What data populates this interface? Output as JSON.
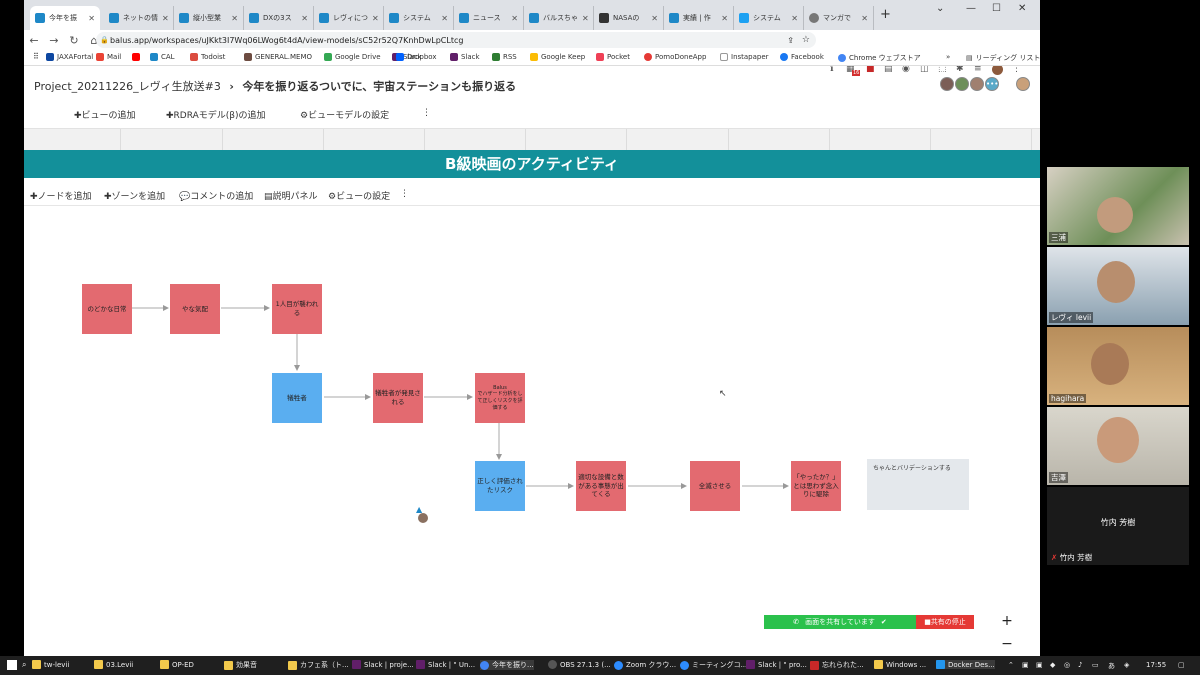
{
  "browser": {
    "tabs": [
      {
        "label": "今年を振",
        "active": true
      },
      {
        "label": "ネットの情"
      },
      {
        "label": "縦小型業"
      },
      {
        "label": "DXの3ス"
      },
      {
        "label": "レヴィにつ"
      },
      {
        "label": "システム"
      },
      {
        "label": "ニュース"
      },
      {
        "label": "バルスちゃ"
      },
      {
        "label": "NASAの"
      },
      {
        "label": "実績 | 作"
      },
      {
        "label": "システム"
      },
      {
        "label": "マンガで"
      }
    ],
    "new_tab": "+",
    "url": "balus.app/workspaces/uJKkt3I7Wq06LWog6t4dA/view-models/sC52r52Q7KnhDwLpCLtcg",
    "badge": "16",
    "bookmarks": [
      "JAXAFortal",
      "Mail",
      "",
      "CAL",
      "Todoist",
      "GENERAL.MEMO",
      "Google Drive",
      "Slack",
      "Dropbox",
      "Slack",
      "RSS",
      "Google Keep",
      "Pocket",
      "PomoDoneApp",
      "Instapaper",
      "Facebook",
      "Chrome ウェブストア"
    ],
    "bookmarks_more": "»",
    "reading_list": "リーディング リスト"
  },
  "app": {
    "breadcrumb": "Project_20211226_レヴィ生放送#3",
    "separator": "›",
    "title": "今年を振り返るついでに、宇宙ステーションも振り返る",
    "model_toolbar": {
      "add_view": "ビューの追加",
      "add_rdra": "RDRAモデル(β)の追加",
      "view_model_settings": "ビューモデルの設定",
      "more": "⋮"
    },
    "view_title": "B級映画のアクティビティ",
    "view_toolbar": {
      "add_node": "ノードを追加",
      "add_zone": "ゾーンを追加",
      "add_comment": "コメントの追加",
      "description_panel": "説明パネル",
      "view_settings": "ビューの設定",
      "more": "⋮"
    },
    "nodes": [
      {
        "label": "のどかな日常",
        "color": "#e36a70"
      },
      {
        "label": "やな気配",
        "color": "#e36a70"
      },
      {
        "label": "1人目が襲われる",
        "color": "#e36a70"
      },
      {
        "label": "犠牲者",
        "color": "#5aaef0"
      },
      {
        "label": "犠牲者が発見される",
        "color": "#e36a70"
      },
      {
        "label": "Balus\nでハザード分析をして正しくリスクを評価する",
        "color": "#e36a70"
      },
      {
        "label": "正しく評価されたリスク",
        "color": "#5aaef0"
      },
      {
        "label": "適切な設備と数がある事態が出てくる",
        "color": "#e36a70"
      },
      {
        "label": "全滅させる",
        "color": "#e36a70"
      },
      {
        "label": "「やったか？」とは思わず念入りに駆除",
        "color": "#e36a70"
      }
    ],
    "comment": "ちゃんとバリデーションする",
    "share": {
      "status": "画面を共有しています",
      "stop": "共有の停止"
    },
    "zoom_in": "+",
    "zoom_out": "−"
  },
  "zoom": {
    "participants": [
      {
        "name": "三浦"
      },
      {
        "name": "レヴィ levii"
      },
      {
        "name": "hagihara"
      },
      {
        "name": "吉澤"
      },
      {
        "name": "竹内 芳樹",
        "display": "竹内 芳樹"
      }
    ]
  },
  "taskbar": {
    "items": [
      "tw-levii",
      "03.Levii",
      "OP-ED",
      "効果音",
      "カフェ系（ト...",
      "Slack | proje...",
      "Slack | \" Un...",
      "今年を振り...",
      "OBS 27.1.3 (...",
      "Zoom クラウ...",
      "ミーティングコ...",
      "Slack | \" pro...",
      "忘れられた...",
      "Windows ...",
      "Docker Des..."
    ],
    "ime": "あ",
    "time": "17:55"
  }
}
